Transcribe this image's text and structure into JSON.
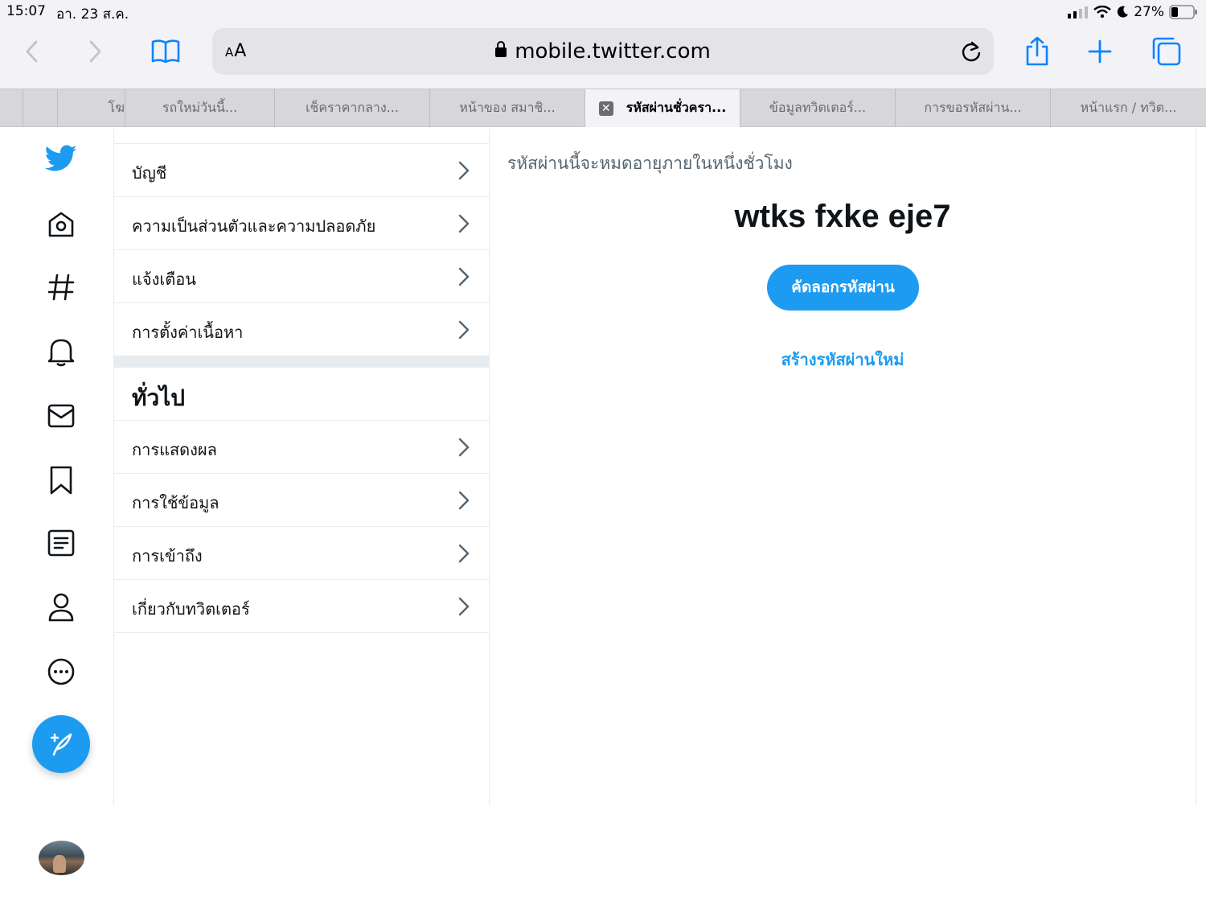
{
  "status_bar": {
    "time": "15:07",
    "date": "อา. 23 ส.ค.",
    "battery": "27%"
  },
  "browser": {
    "aa_label": "AA",
    "url": "mobile.twitter.com",
    "tabs": [
      {
        "label": ""
      },
      {
        "label": "โฆ"
      },
      {
        "label": "รถใหม่วันนี้..."
      },
      {
        "label": "เช็คราคากลาง..."
      },
      {
        "label": "หน้าของ สมาชิ..."
      },
      {
        "label": "รหัสผ่านชั่วครา...",
        "active": true
      },
      {
        "label": "ข้อมูลทวิตเตอร์..."
      },
      {
        "label": "การขอรหัสผ่าน..."
      },
      {
        "label": "หน้าแรก / ทวิต..."
      }
    ]
  },
  "nav_icons": [
    "twitter-bird-icon",
    "home-icon",
    "explore-hashtag-icon",
    "notifications-bell-icon",
    "messages-envelope-icon",
    "bookmarks-icon",
    "lists-icon",
    "profile-icon",
    "more-icon"
  ],
  "settings": {
    "rows_top": [
      {
        "label": "บัญชี"
      },
      {
        "label": "ความเป็นส่วนตัวและความปลอดภัย"
      },
      {
        "label": "แจ้งเตือน"
      },
      {
        "label": "การตั้งค่าเนื้อหา"
      }
    ],
    "section_title": "ทั่วไป",
    "rows_general": [
      {
        "label": "การแสดงผล"
      },
      {
        "label": "การใช้ข้อมูล"
      },
      {
        "label": "การเข้าถึง"
      },
      {
        "label": "เกี่ยวกับทวิตเตอร์"
      }
    ]
  },
  "main": {
    "expire_text": "รหัสผ่านนี้จะหมดอายุภายในหนึ่งชั่วโมง",
    "password": "wtks fxke eje7",
    "copy_button": "คัดลอกรหัสผ่าน",
    "regenerate_link": "สร้างรหัสผ่านใหม่"
  },
  "colors": {
    "accent": "#1d9bf0",
    "ios_blue": "#0a84ff",
    "text": "#0f1419",
    "secondary_text": "#536471"
  }
}
